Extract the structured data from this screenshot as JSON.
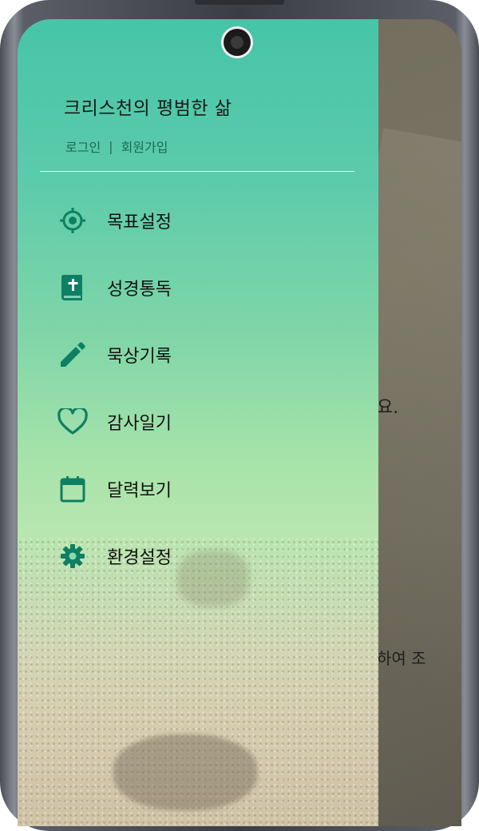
{
  "app": {
    "title": "크리스천의 평범한 삶"
  },
  "auth": {
    "login": "로그인",
    "separator": "|",
    "signup": "회원가입"
  },
  "menu": {
    "items": [
      {
        "label": "목표설정",
        "icon": "target-icon"
      },
      {
        "label": "성경통독",
        "icon": "bible-icon"
      },
      {
        "label": "묵상기록",
        "icon": "pencil-icon"
      },
      {
        "label": "감사일기",
        "icon": "heart-icon"
      },
      {
        "label": "달력보기",
        "icon": "calendar-icon"
      },
      {
        "label": "환경설정",
        "icon": "gear-icon"
      }
    ]
  },
  "background": {
    "text1": "요.",
    "text2": "하여 조"
  },
  "colors": {
    "accent": "#0e7f63",
    "drawer_top": "#47c4a8",
    "text": "#111111"
  }
}
